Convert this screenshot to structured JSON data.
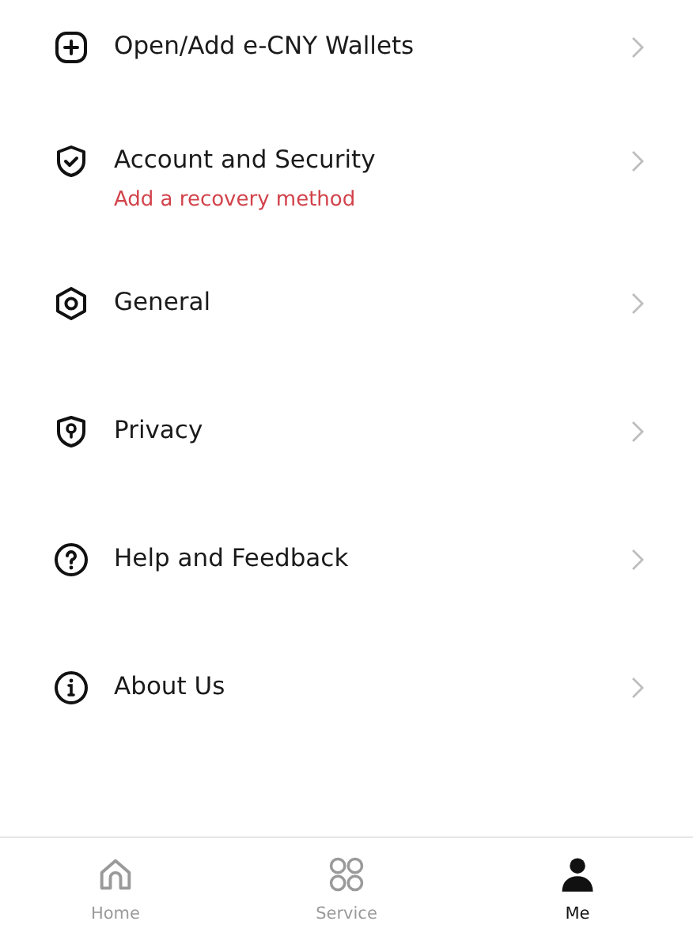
{
  "menu": [
    {
      "kind": "add",
      "label": "Open/Add e-CNY Wallets"
    },
    {
      "kind": "shield-check",
      "label": "Account and Security",
      "note": "Add a recovery method"
    },
    {
      "kind": "hex-gear",
      "label": "General"
    },
    {
      "kind": "shield-keyhole",
      "label": "Privacy"
    },
    {
      "kind": "help",
      "label": "Help and Feedback"
    },
    {
      "kind": "info",
      "label": "About Us"
    }
  ],
  "tab_bar": [
    {
      "kind": "home",
      "label": "Home",
      "selected": false
    },
    {
      "kind": "service",
      "label": "Service",
      "selected": false
    },
    {
      "kind": "me",
      "label": "Me",
      "selected": true
    }
  ]
}
